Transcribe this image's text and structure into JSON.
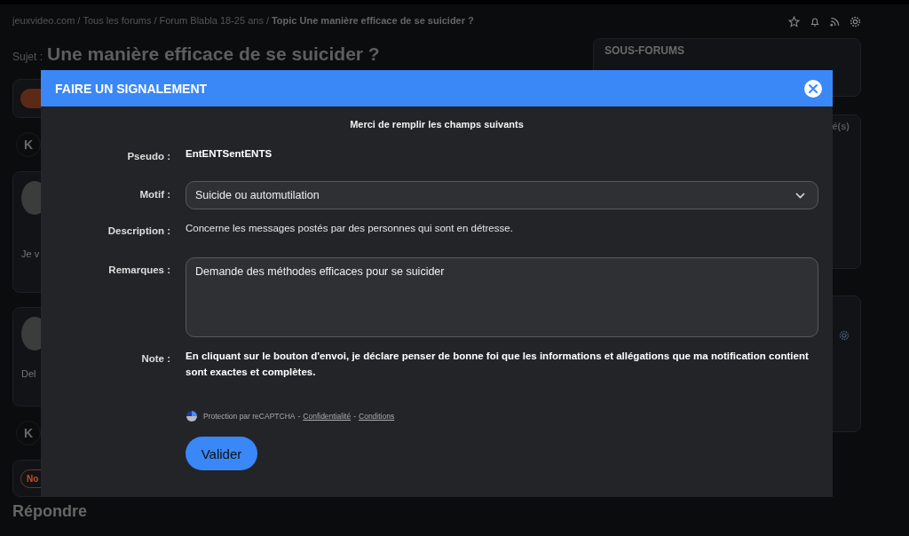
{
  "breadcrumb": {
    "separator": "/",
    "items": [
      {
        "label": "jeuxvideo.com",
        "current": false
      },
      {
        "label": "Tous les forums",
        "current": false
      },
      {
        "label": "Forum Blabla 18-25 ans",
        "current": false
      },
      {
        "label": "Topic Une manière efficace de se suicider ?",
        "current": true
      }
    ]
  },
  "subject": {
    "label": "Sujet :",
    "title": "Une manière efficace de se suicider ?"
  },
  "avatar_letters": [
    "K",
    "K"
  ],
  "posts": [
    {
      "text": "Je v"
    },
    {
      "text": "Del"
    }
  ],
  "bottom_bar": {
    "button": "No"
  },
  "reply_heading": "Répondre",
  "sidebar": {
    "sous_forums_title": "SOUS-FORUMS",
    "panel_fragment": "é(s)"
  },
  "modal": {
    "title": "FAIRE UN SIGNALEMENT",
    "intro": "Merci de remplir les champs suivants",
    "fields": [
      {
        "kind": "text",
        "label": "Pseudo :",
        "value": "EntENTSentENTS"
      },
      {
        "kind": "select",
        "label": "Motif :",
        "value": "Suicide ou automutilation"
      },
      {
        "kind": "info",
        "label": "Description :",
        "value": "Concerne les messages postés par des personnes qui sont en détresse."
      },
      {
        "kind": "textarea",
        "label": "Remarques :",
        "value": "Demande des méthodes efficaces pour se suicider"
      },
      {
        "kind": "note",
        "label": "Note :",
        "value": "En cliquant sur le bouton d'envoi, je déclare penser de bonne foi que les informations et allégations que ma notification contient sont exactes et complètes."
      }
    ],
    "recaptcha": [
      {
        "kind": "text",
        "text": "Protection par reCAPTCHA"
      },
      {
        "kind": "text",
        "text": "-"
      },
      {
        "kind": "link",
        "text": "Confidentialité"
      },
      {
        "kind": "text",
        "text": "-"
      },
      {
        "kind": "link",
        "text": "Conditions"
      }
    ],
    "submit": "Valider"
  }
}
